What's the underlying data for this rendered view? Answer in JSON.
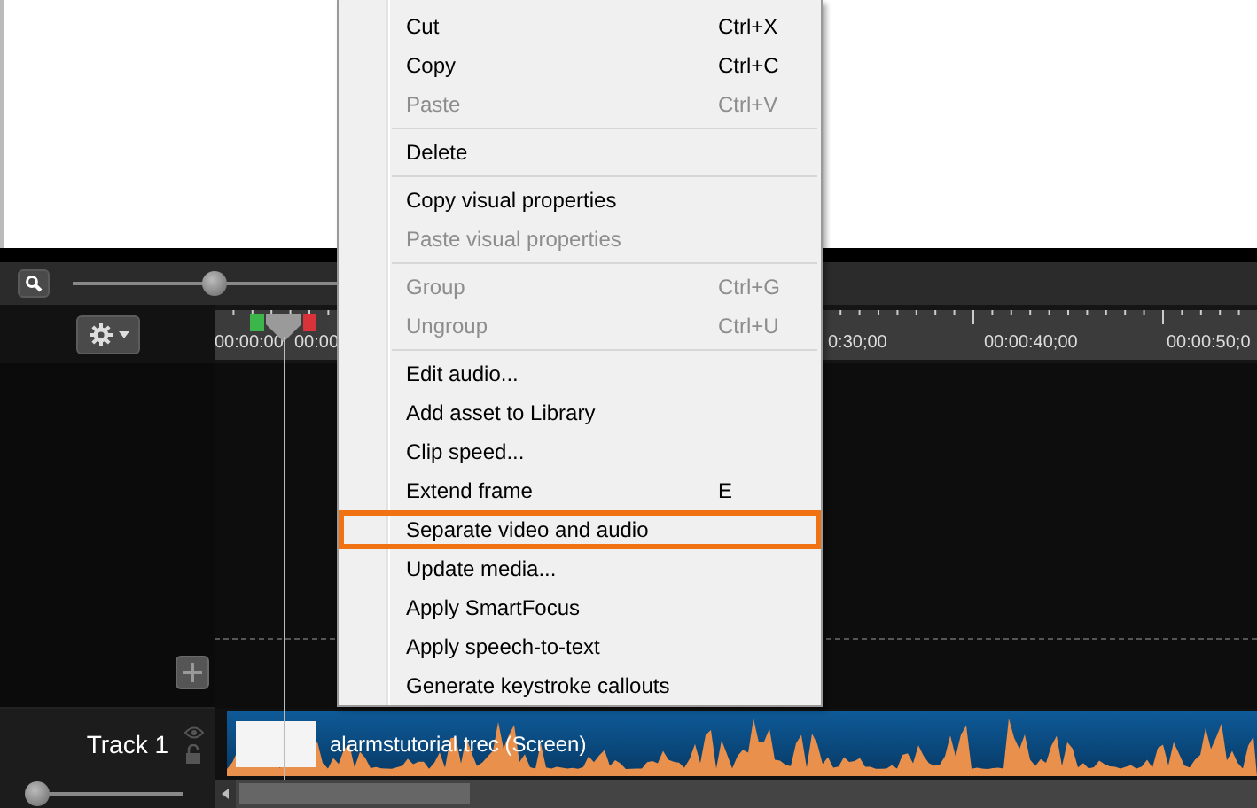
{
  "zoom_slider": {
    "level": 0.5
  },
  "ruler": {
    "labels": [
      "00:00:00",
      "00:00",
      "0:30;00",
      "00:00:40;00",
      "00:00:50;0"
    ]
  },
  "tracks": [
    {
      "name": "Track 1",
      "clip": {
        "label": "alarmstutorial.trec (Screen)"
      }
    }
  ],
  "track_height_slider": {
    "level": 0.05
  },
  "context_menu": {
    "items": [
      {
        "kind": "item",
        "label": "Cut",
        "shortcut": "Ctrl+X",
        "disabled": false,
        "annotated": false
      },
      {
        "kind": "item",
        "label": "Copy",
        "shortcut": "Ctrl+C",
        "disabled": false,
        "annotated": false
      },
      {
        "kind": "item",
        "label": "Paste",
        "shortcut": "Ctrl+V",
        "disabled": true,
        "annotated": false
      },
      {
        "kind": "separator"
      },
      {
        "kind": "item",
        "label": "Delete",
        "disabled": false,
        "annotated": false
      },
      {
        "kind": "separator"
      },
      {
        "kind": "item",
        "label": "Copy visual properties",
        "disabled": false,
        "annotated": false
      },
      {
        "kind": "item",
        "label": "Paste visual properties",
        "disabled": true,
        "annotated": false
      },
      {
        "kind": "separator"
      },
      {
        "kind": "item",
        "label": "Group",
        "shortcut": "Ctrl+G",
        "disabled": true,
        "annotated": false
      },
      {
        "kind": "item",
        "label": "Ungroup",
        "shortcut": "Ctrl+U",
        "disabled": true,
        "annotated": false
      },
      {
        "kind": "separator"
      },
      {
        "kind": "item",
        "label": "Edit audio...",
        "disabled": false,
        "annotated": false
      },
      {
        "kind": "item",
        "label": "Add asset to Library",
        "disabled": false,
        "annotated": false
      },
      {
        "kind": "item",
        "label": "Clip speed...",
        "disabled": false,
        "annotated": false
      },
      {
        "kind": "item",
        "label": "Extend frame",
        "shortcut": "E",
        "disabled": false,
        "annotated": false
      },
      {
        "kind": "item",
        "label": "Separate video and audio",
        "disabled": false,
        "annotated": true
      },
      {
        "kind": "item",
        "label": "Update media...",
        "disabled": false,
        "annotated": false
      },
      {
        "kind": "item",
        "label": "Apply SmartFocus",
        "disabled": false,
        "annotated": false
      },
      {
        "kind": "item",
        "label": "Apply speech-to-text",
        "disabled": false,
        "annotated": false
      },
      {
        "kind": "item",
        "label": "Generate keystroke callouts",
        "disabled": false,
        "annotated": false
      }
    ]
  }
}
